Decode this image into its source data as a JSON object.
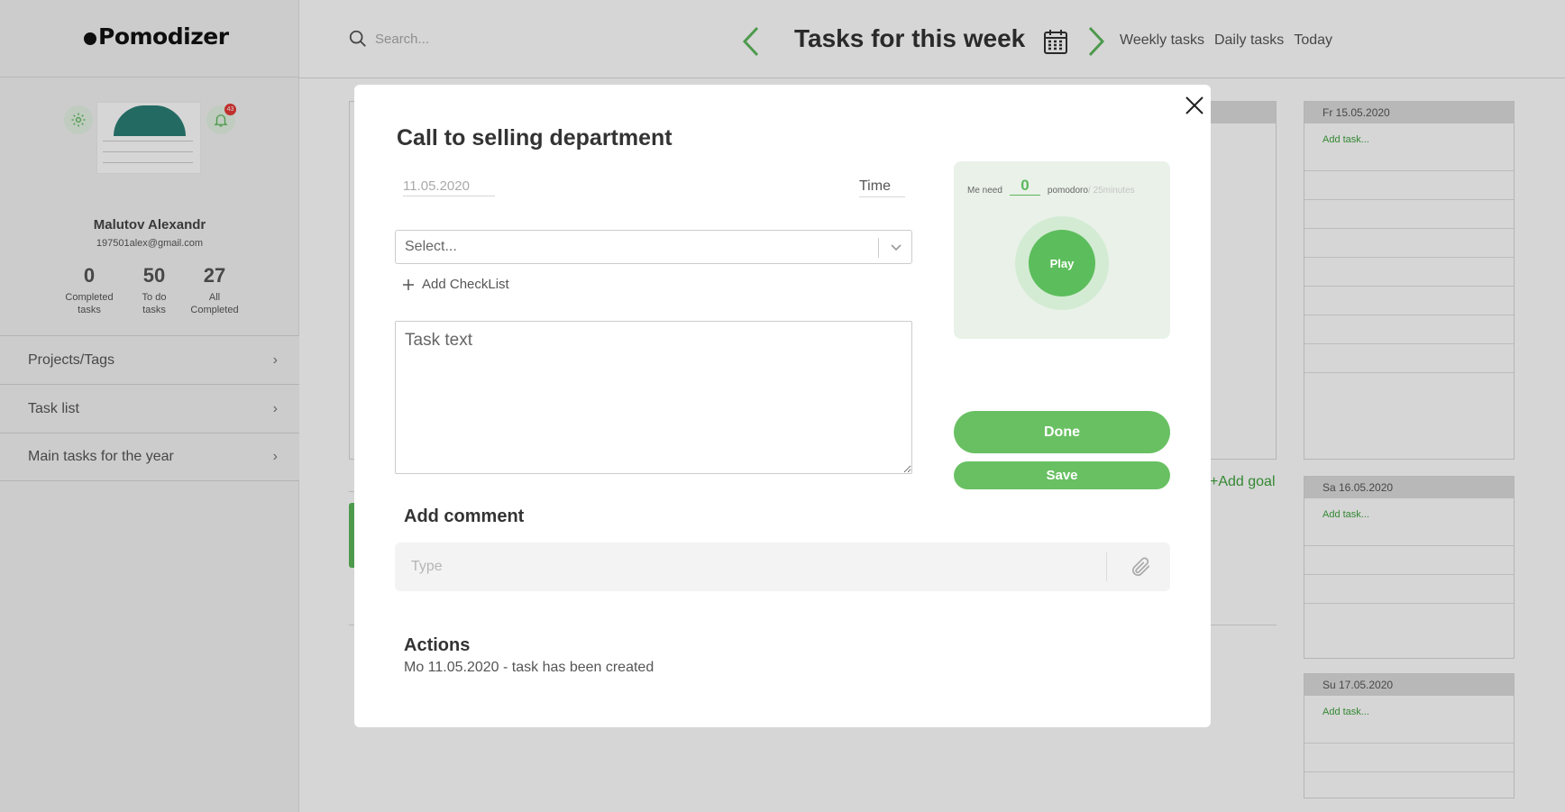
{
  "app": {
    "logo": "Pomodizer"
  },
  "user": {
    "name": "Malutov Alexandr",
    "email": "197501alex@gmail.com",
    "notifications": "43",
    "stats": [
      {
        "value": "0",
        "label_line1": "Completed",
        "label_line2": "tasks"
      },
      {
        "value": "50",
        "label_line1": "To do",
        "label_line2": "tasks"
      },
      {
        "value": "27",
        "label_line1": "All",
        "label_line2": "Completed"
      }
    ]
  },
  "sidebar": {
    "items": [
      {
        "label": "Projects/Tags"
      },
      {
        "label": "Task list"
      },
      {
        "label": "Main tasks for the year"
      }
    ]
  },
  "header": {
    "search_placeholder": "Search...",
    "title": "Tasks for this week",
    "views": [
      "Weekly tasks",
      "Daily tasks",
      "Today"
    ]
  },
  "board": {
    "days": [
      {
        "label": "Fr 15.05.2020",
        "add": "Add task..."
      },
      {
        "label": "Sa 16.05.2020",
        "add": "Add task..."
      },
      {
        "label": "Su 17.05.2020",
        "add": "Add task..."
      }
    ],
    "add_goal": "+Add goal"
  },
  "modal": {
    "title": "Call to selling department",
    "date": "11.05.2020",
    "time_label": "Time",
    "select_placeholder": "Select...",
    "add_checklist": "Add CheckList",
    "task_text_placeholder": "Task text",
    "pomodoro": {
      "prefix": "Me need",
      "count": "0",
      "unit": "pomodoro",
      "duration": "/ 25minutes",
      "play_label": "Play"
    },
    "done_label": "Done",
    "save_label": "Save",
    "comment_title": "Add comment",
    "comment_placeholder": "Type",
    "actions_title": "Actions",
    "actions_entries": [
      "Mo 11.05.2020 - task has been created"
    ]
  },
  "colors": {
    "accent_green": "#69c062",
    "link_green": "#3ea33e",
    "badge_red": "#e53935"
  }
}
